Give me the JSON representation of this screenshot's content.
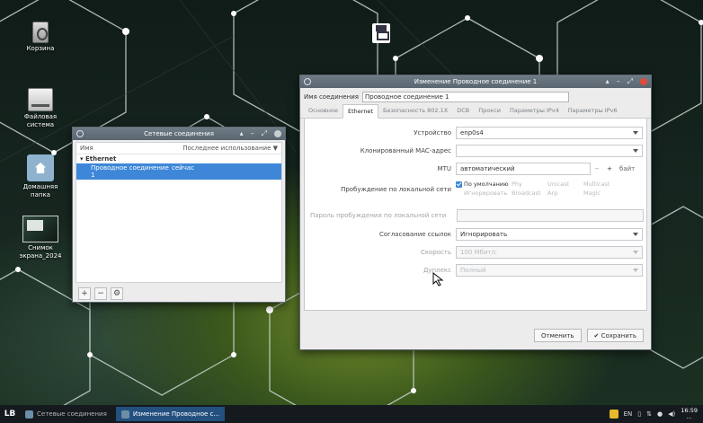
{
  "desktop": {
    "icons": [
      {
        "label": "Корзина",
        "icon": "trash-icon"
      },
      {
        "label": "Файловая система",
        "icon": "drive-icon"
      },
      {
        "label": "Домашняя папка",
        "icon": "home-folder-icon"
      },
      {
        "label": "Снимок экрана_2024",
        "icon": "screenshot-file-icon"
      }
    ]
  },
  "connections_window": {
    "title": "Сетевые соединения",
    "col_name": "Имя",
    "col_last_used": "Последнее использование ▼",
    "group": "Ethernet",
    "rows": [
      {
        "name": "Проводное соединение 1",
        "last_used": "сейчас"
      }
    ],
    "toolbar": {
      "add": "+",
      "remove": "−",
      "settings": "⚙"
    }
  },
  "edit_window": {
    "title": "Изменение Проводное соединение 1",
    "name_label": "Имя соединения",
    "name_value": "Проводное соединение 1",
    "tabs": [
      "Основное",
      "Ethernet",
      "Безопасность 802.1X",
      "DCB",
      "Прокси",
      "Параметры IPv4",
      "Параметры IPv6"
    ],
    "active_tab": "Ethernet",
    "fields": {
      "device_label": "Устройство",
      "device_value": "enp0s4",
      "cloned_mac_label": "Клонированный MAC-адрес",
      "cloned_mac_value": "",
      "mtu_label": "MTU",
      "mtu_value": "автоматический",
      "mtu_minus": "−",
      "mtu_plus": "+",
      "mtu_unit": "байт",
      "wol_label": "Пробуждение по локальной сети",
      "wol_options": [
        "По умолчанию",
        "Phy",
        "Unicast",
        "Multicast",
        "Игнорировать",
        "Broadcast",
        "Arp",
        "Magic"
      ],
      "wol_password_label": "Пароль пробуждения по локальной сети",
      "wol_password_value": "",
      "link_negotiation_label": "Согласование ссылок",
      "link_negotiation_value": "Игнорировать",
      "speed_label": "Скорость",
      "speed_value": "100 Мбит/с",
      "duplex_label": "Дуплекс",
      "duplex_value": "Полный"
    },
    "cancel_label": "Отменить",
    "save_label": "✔ Сохранить"
  },
  "taskbar": {
    "logo": "LB",
    "tasks": [
      {
        "label": "Сетевые соединения",
        "active": false
      },
      {
        "label": "Изменение Проводное с...",
        "active": true
      }
    ],
    "lang": "EN",
    "time": "16:59",
    "date": "..."
  }
}
